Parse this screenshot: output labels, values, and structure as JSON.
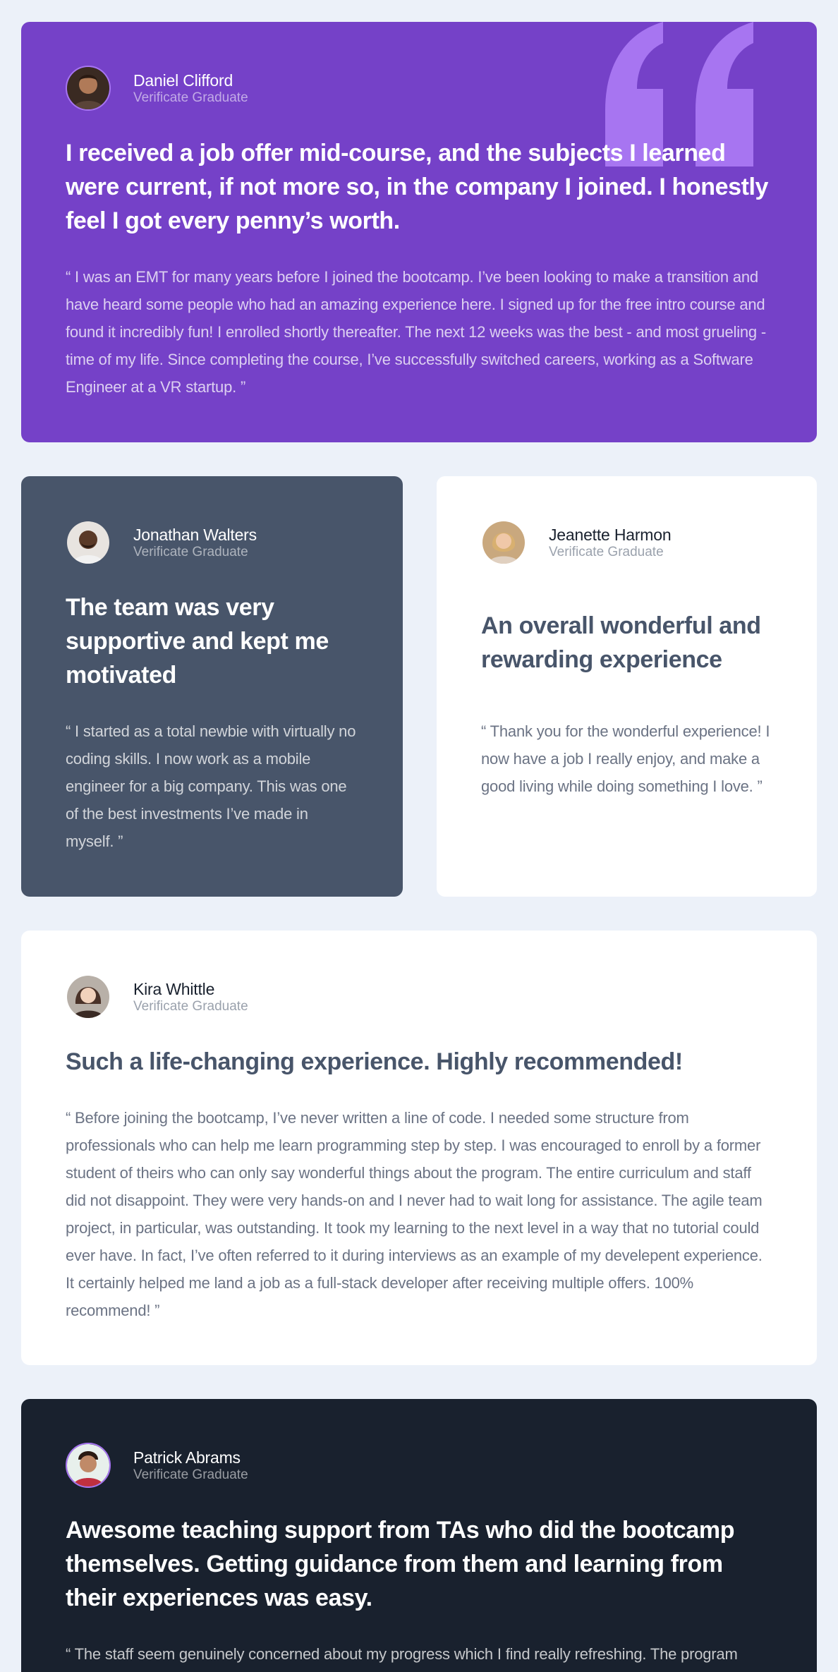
{
  "testimonials": [
    {
      "name": "Daniel Clifford",
      "role": "Verificate Graduate",
      "headline": "I received a job offer mid-course, and the subjects I learned were current, if not more so, in the company I joined. I honestly feel I got every penny’s worth.",
      "quote": "“ I was an EMT for many years before I joined the bootcamp. I’ve been looking to make a transition and have heard some people who had an amazing experience here. I signed up for the free intro course and found it incredibly fun! I enrolled shortly thereafter. The next 12 weeks was the best - and most grueling - time of my life. Since completing the course, I’ve successfully switched careers, working as a Software Engineer at a VR startup. ”"
    },
    {
      "name": "Jonathan Walters",
      "role": "Verificate Graduate",
      "headline": "The team was very supportive and kept me motivated",
      "quote": "“ I started as a total newbie with virtually no coding skills. I now work as a mobile engineer for a big company. This was one of the best investments I’ve made in myself. ”"
    },
    {
      "name": "Jeanette Harmon",
      "role": "Verificate Graduate",
      "headline": "An overall wonderful and rewarding experience",
      "quote": "“ Thank you for the wonderful experience! I now have a job I really enjoy, and make a good living while doing something I love. ”"
    },
    {
      "name": "Kira Whittle",
      "role": "Verificate Graduate",
      "headline": "Such a life-changing experience. Highly recommended!",
      "quote": "“ Before joining the bootcamp, I’ve never written a line of code. I needed some structure from professionals who can help me learn programming step by step. I was encouraged to enroll by a former student of theirs who can only say wonderful things about the program. The entire curriculum and staff did not disappoint. They were very hands-on and I never had to wait long for assistance. The agile team project, in particular, was outstanding. It took my learning to the next level in a way that no tutorial could ever have. In fact, I’ve often referred to it during interviews as an example of my develepent experience. It certainly helped me land a job as a full-stack developer after receiving multiple offers. 100% recommend! ”"
    },
    {
      "name": "Patrick Abrams",
      "role": "Verificate Graduate",
      "headline": "Awesome teaching support from TAs who did the bootcamp themselves. Getting guidance from them and learning from their experiences was easy.",
      "quote": "“ The staff seem genuinely concerned about my progress which I find really refreshing. The program gave me the confidence necessary to be able to go out in the world and present myself as a capable junior developer. The standard is above the rest. You will get the personal attention you need from an incredible community of smart and amazing people. ”"
    }
  ],
  "colors": {
    "background": "#ecf1f9",
    "moderate_violet": "#7541c8",
    "grayish_blue": "#48556a",
    "very_dark_blue": "#19212e",
    "white": "#ffffff"
  },
  "icons": {
    "quotation": "quotation-icon",
    "avatar": "avatar-icon"
  }
}
